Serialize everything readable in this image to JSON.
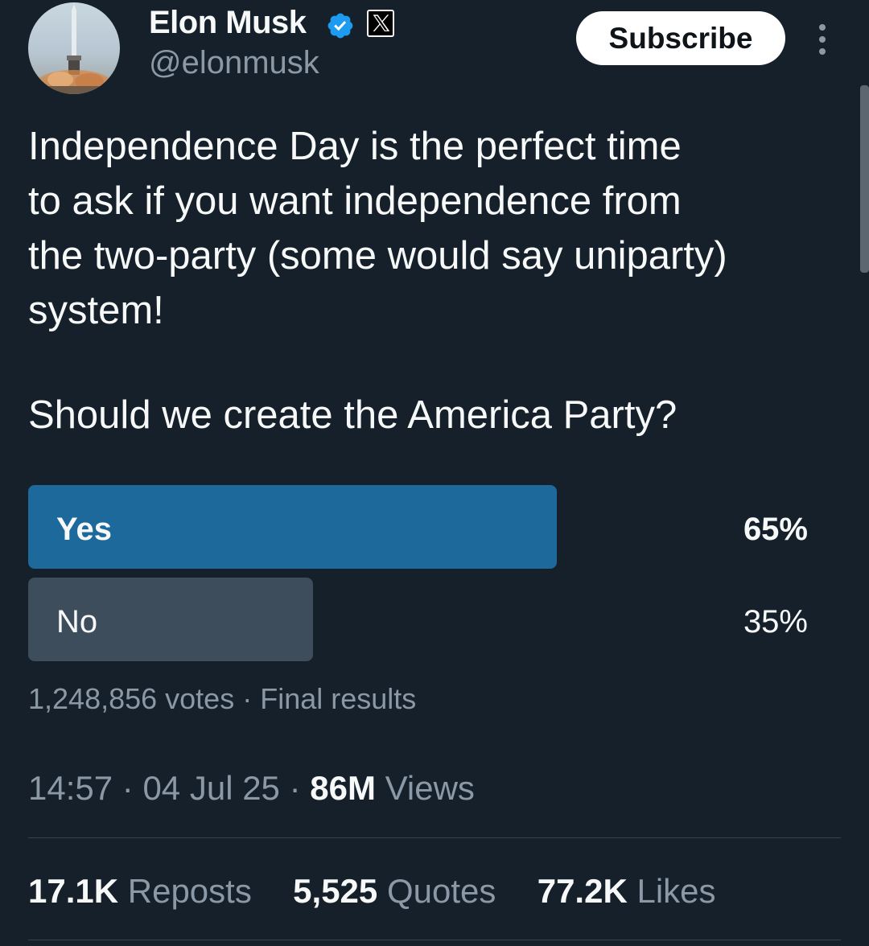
{
  "author": {
    "name": "Elon Musk",
    "handle": "@elonmusk",
    "verified_icon": "verified-badge-icon",
    "affiliate_icon": "x-logo-icon"
  },
  "header": {
    "subscribe_label": "Subscribe",
    "more_icon": "more-options-icon"
  },
  "post": {
    "text_lines": [
      "Independence Day is the perfect time",
      "to ask if you want independence from",
      "the two-party (some would say uniparty)",
      "system!"
    ],
    "question": "Should we create the America Party?"
  },
  "poll": {
    "options": [
      {
        "label": "Yes",
        "percent_text": "65%",
        "percent": 65,
        "winner": true
      },
      {
        "label": "No",
        "percent_text": "35%",
        "percent": 35,
        "winner": false
      }
    ],
    "votes": "1,248,856 votes",
    "separator": "·",
    "status": "Final results"
  },
  "timestamp": {
    "time": "14:57",
    "date": "04 Jul 25",
    "views_count": "86M",
    "views_label": "Views",
    "separator": "·"
  },
  "stats": {
    "reposts": {
      "count": "17.1K",
      "label": "Reposts"
    },
    "quotes": {
      "count": "5,525",
      "label": "Quotes"
    },
    "likes": {
      "count": "77.2K",
      "label": "Likes"
    }
  },
  "colors": {
    "background": "#15202b",
    "winner_bar": "#1d699b",
    "other_bar": "#3d4d5c",
    "verified_blue": "#1d9bf0",
    "secondary_text": "#8b98a5"
  }
}
